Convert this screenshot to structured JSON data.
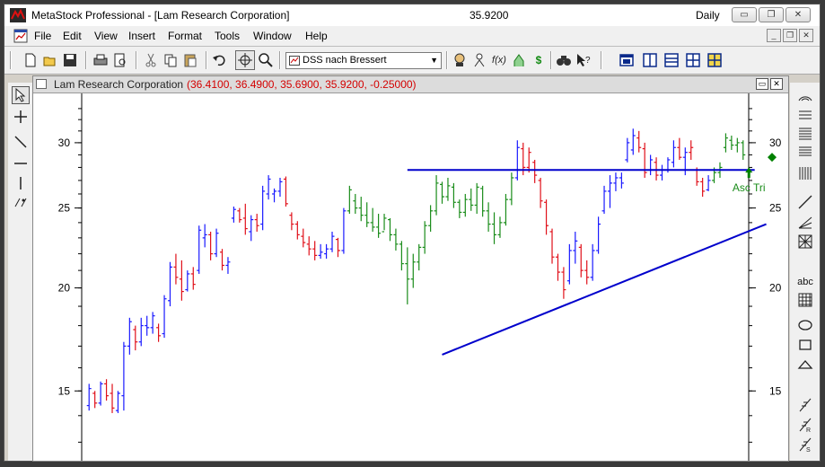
{
  "window": {
    "title": "MetaStock Professional - [Lam Research Corporation]",
    "price": "35.9200",
    "period": "Daily",
    "minimize": "▭",
    "restore": "❐",
    "close": "✕"
  },
  "menu": {
    "items": [
      "File",
      "Edit",
      "View",
      "Insert",
      "Format",
      "Tools",
      "Window",
      "Help"
    ],
    "mdi_minimize": "_",
    "mdi_restore": "❐",
    "mdi_close": "✕"
  },
  "toolbar": {
    "combo_value": "DSS nach Bressert",
    "icons": [
      "new-icon",
      "open-icon",
      "save-icon",
      "print-icon",
      "print-preview-icon",
      "cut-icon",
      "copy-icon",
      "paste-icon",
      "undo-icon",
      "crosshair-icon",
      "zoom-icon",
      "expert-icon",
      "explorer-icon",
      "formula-icon",
      "indicator-icon",
      "dollar-icon",
      "binoculars-icon",
      "help-pointer-icon",
      "tile-icon",
      "cascade-icon",
      "horizontal-icon",
      "vertical-icon",
      "smart-chart-icon"
    ],
    "formula_label": "f(x)",
    "dollar_label": "$"
  },
  "chart_window": {
    "name": "Lam Research Corporation",
    "values": "(36.4100, 36.4900, 35.6900, 35.9200, -0.25000)"
  },
  "chart_data": {
    "type": "ohlc-bar",
    "symbol": "Lam Research Corporation",
    "scale": "log",
    "ylim": [
      12.5,
      34
    ],
    "yticks": [
      15,
      20,
      25,
      30
    ],
    "colors": {
      "up": "#1a1aff",
      "down": "#e0101a",
      "neutral": "#1a8c1a",
      "trendline": "#0000cc",
      "signal": "#008000"
    },
    "annotation": {
      "text": "Asc Tri",
      "color": "#1a8c1a"
    },
    "trendlines": [
      {
        "name": "resistance",
        "from": {
          "bar": 55,
          "price": 27.8
        },
        "to": {
          "bar": 115,
          "price": 27.8
        }
      },
      {
        "name": "support",
        "from": {
          "bar": 61,
          "price": 16.6
        },
        "to": {
          "bar": 117,
          "price": 23.9
        }
      }
    ],
    "bars": [
      {
        "h": 15.3,
        "l": 14.2,
        "o": 14.4,
        "c": 15.1,
        "col": "up"
      },
      {
        "h": 15.0,
        "l": 14.3,
        "o": 14.9,
        "c": 14.5,
        "col": "down"
      },
      {
        "h": 15.4,
        "l": 14.4,
        "o": 14.5,
        "c": 15.3,
        "col": "up"
      },
      {
        "h": 15.5,
        "l": 14.6,
        "o": 15.3,
        "c": 14.8,
        "col": "down"
      },
      {
        "h": 15.3,
        "l": 14.1,
        "o": 14.9,
        "c": 14.3,
        "col": "down"
      },
      {
        "h": 15.0,
        "l": 14.1,
        "o": 14.2,
        "c": 14.9,
        "col": "up"
      },
      {
        "h": 17.2,
        "l": 14.2,
        "o": 14.8,
        "c": 17.0,
        "col": "up"
      },
      {
        "h": 18.4,
        "l": 16.6,
        "o": 17.0,
        "c": 18.2,
        "col": "up"
      },
      {
        "h": 18.0,
        "l": 16.8,
        "o": 17.8,
        "c": 17.2,
        "col": "down"
      },
      {
        "h": 18.4,
        "l": 17.0,
        "o": 17.2,
        "c": 18.0,
        "col": "up"
      },
      {
        "h": 18.5,
        "l": 17.5,
        "o": 18.0,
        "c": 17.9,
        "col": "up"
      },
      {
        "h": 18.7,
        "l": 17.6,
        "o": 17.9,
        "c": 18.5,
        "col": "up"
      },
      {
        "h": 18.1,
        "l": 17.2,
        "o": 17.9,
        "c": 17.5,
        "col": "down"
      },
      {
        "h": 19.6,
        "l": 17.4,
        "o": 17.6,
        "c": 19.4,
        "col": "up"
      },
      {
        "h": 21.5,
        "l": 19.0,
        "o": 19.3,
        "c": 21.2,
        "col": "up"
      },
      {
        "h": 22.0,
        "l": 20.2,
        "o": 21.2,
        "c": 20.6,
        "col": "down"
      },
      {
        "h": 21.6,
        "l": 19.3,
        "o": 20.5,
        "c": 19.8,
        "col": "down"
      },
      {
        "h": 21.0,
        "l": 19.8,
        "o": 19.9,
        "c": 20.8,
        "col": "up"
      },
      {
        "h": 21.2,
        "l": 19.9,
        "o": 20.8,
        "c": 20.2,
        "col": "down"
      },
      {
        "h": 23.8,
        "l": 20.8,
        "o": 21.0,
        "c": 23.5,
        "col": "up"
      },
      {
        "h": 23.9,
        "l": 22.4,
        "o": 23.0,
        "c": 23.2,
        "col": "up"
      },
      {
        "h": 23.4,
        "l": 21.6,
        "o": 23.2,
        "c": 22.0,
        "col": "down"
      },
      {
        "h": 23.6,
        "l": 21.8,
        "o": 22.0,
        "c": 23.3,
        "col": "up"
      },
      {
        "h": 22.3,
        "l": 21.0,
        "o": 22.1,
        "c": 21.3,
        "col": "down"
      },
      {
        "h": 21.8,
        "l": 20.8,
        "o": 21.3,
        "c": 21.5,
        "col": "up"
      },
      {
        "h": 25.1,
        "l": 24.0,
        "o": 24.3,
        "c": 24.9,
        "col": "up"
      },
      {
        "h": 25.0,
        "l": 24.0,
        "o": 24.8,
        "c": 24.2,
        "col": "down"
      },
      {
        "h": 25.3,
        "l": 23.2,
        "o": 24.3,
        "c": 23.6,
        "col": "down"
      },
      {
        "h": 24.5,
        "l": 22.8,
        "o": 23.4,
        "c": 24.2,
        "col": "up"
      },
      {
        "h": 24.6,
        "l": 23.4,
        "o": 24.2,
        "c": 23.8,
        "col": "down"
      },
      {
        "h": 26.6,
        "l": 23.5,
        "o": 23.9,
        "c": 26.2,
        "col": "up"
      },
      {
        "h": 27.4,
        "l": 25.6,
        "o": 26.0,
        "c": 27.1,
        "col": "up"
      },
      {
        "h": 26.4,
        "l": 25.4,
        "o": 26.0,
        "c": 26.2,
        "col": "up"
      },
      {
        "h": 27.2,
        "l": 25.8,
        "o": 26.2,
        "c": 26.9,
        "col": "up"
      },
      {
        "h": 27.3,
        "l": 25.1,
        "o": 27.1,
        "c": 25.3,
        "col": "down"
      },
      {
        "h": 24.7,
        "l": 23.5,
        "o": 24.5,
        "c": 23.9,
        "col": "down"
      },
      {
        "h": 24.1,
        "l": 22.9,
        "o": 23.9,
        "c": 23.2,
        "col": "down"
      },
      {
        "h": 23.6,
        "l": 22.4,
        "o": 23.1,
        "c": 22.7,
        "col": "down"
      },
      {
        "h": 23.1,
        "l": 21.9,
        "o": 22.6,
        "c": 22.3,
        "col": "down"
      },
      {
        "h": 22.8,
        "l": 21.6,
        "o": 22.3,
        "c": 21.9,
        "col": "down"
      },
      {
        "h": 22.6,
        "l": 21.7,
        "o": 21.9,
        "c": 22.1,
        "col": "up"
      },
      {
        "h": 22.6,
        "l": 21.7,
        "o": 22.0,
        "c": 22.3,
        "col": "up"
      },
      {
        "h": 23.4,
        "l": 22.1,
        "o": 22.3,
        "c": 23.1,
        "col": "up"
      },
      {
        "h": 23.0,
        "l": 21.8,
        "o": 22.9,
        "c": 22.2,
        "col": "down"
      },
      {
        "h": 25.0,
        "l": 22.0,
        "o": 22.2,
        "c": 24.8,
        "col": "up"
      },
      {
        "h": 26.6,
        "l": 24.6,
        "o": 24.8,
        "c": 26.3,
        "col": "neutral"
      },
      {
        "h": 26.0,
        "l": 24.6,
        "o": 25.5,
        "c": 25.0,
        "col": "neutral"
      },
      {
        "h": 25.8,
        "l": 24.1,
        "o": 25.0,
        "c": 24.5,
        "col": "neutral"
      },
      {
        "h": 25.4,
        "l": 23.7,
        "o": 24.5,
        "c": 24.0,
        "col": "neutral"
      },
      {
        "h": 25.0,
        "l": 23.4,
        "o": 24.0,
        "c": 23.7,
        "col": "neutral"
      },
      {
        "h": 24.6,
        "l": 23.0,
        "o": 23.7,
        "c": 23.3,
        "col": "neutral"
      },
      {
        "h": 24.6,
        "l": 23.5,
        "o": 23.4,
        "c": 24.3,
        "col": "neutral"
      },
      {
        "h": 24.3,
        "l": 22.8,
        "o": 24.2,
        "c": 23.2,
        "col": "neutral"
      },
      {
        "h": 23.6,
        "l": 22.2,
        "o": 23.2,
        "c": 22.6,
        "col": "neutral"
      },
      {
        "h": 22.8,
        "l": 21.0,
        "o": 22.6,
        "c": 21.4,
        "col": "neutral"
      },
      {
        "h": 22.4,
        "l": 19.1,
        "o": 21.4,
        "c": 20.5,
        "col": "neutral"
      },
      {
        "h": 22.0,
        "l": 20.0,
        "o": 20.5,
        "c": 21.5,
        "col": "neutral"
      },
      {
        "h": 22.6,
        "l": 21.0,
        "o": 21.5,
        "c": 22.4,
        "col": "neutral"
      },
      {
        "h": 24.1,
        "l": 22.0,
        "o": 22.4,
        "c": 23.8,
        "col": "neutral"
      },
      {
        "h": 25.2,
        "l": 23.4,
        "o": 23.8,
        "c": 24.8,
        "col": "neutral"
      },
      {
        "h": 27.4,
        "l": 24.5,
        "o": 24.8,
        "c": 26.8,
        "col": "neutral"
      },
      {
        "h": 26.9,
        "l": 25.3,
        "o": 26.7,
        "c": 25.8,
        "col": "neutral"
      },
      {
        "h": 27.2,
        "l": 25.5,
        "o": 25.8,
        "c": 26.6,
        "col": "neutral"
      },
      {
        "h": 26.8,
        "l": 25.0,
        "o": 26.5,
        "c": 25.4,
        "col": "neutral"
      },
      {
        "h": 25.6,
        "l": 24.3,
        "o": 25.4,
        "c": 24.7,
        "col": "neutral"
      },
      {
        "h": 26.0,
        "l": 24.4,
        "o": 24.7,
        "c": 25.6,
        "col": "neutral"
      },
      {
        "h": 26.4,
        "l": 24.8,
        "o": 25.6,
        "c": 25.2,
        "col": "neutral"
      },
      {
        "h": 26.8,
        "l": 24.6,
        "o": 25.2,
        "c": 26.5,
        "col": "neutral"
      },
      {
        "h": 26.6,
        "l": 24.4,
        "o": 26.4,
        "c": 24.8,
        "col": "neutral"
      },
      {
        "h": 25.4,
        "l": 23.4,
        "o": 24.8,
        "c": 23.9,
        "col": "neutral"
      },
      {
        "h": 24.7,
        "l": 22.6,
        "o": 23.9,
        "c": 23.2,
        "col": "neutral"
      },
      {
        "h": 24.4,
        "l": 23.0,
        "o": 23.2,
        "c": 24.0,
        "col": "neutral"
      },
      {
        "h": 26.0,
        "l": 23.8,
        "o": 24.0,
        "c": 25.6,
        "col": "neutral"
      },
      {
        "h": 27.6,
        "l": 25.2,
        "o": 25.6,
        "c": 27.2,
        "col": "neutral"
      },
      {
        "h": 30.2,
        "l": 27.0,
        "o": 27.2,
        "c": 29.6,
        "col": "up"
      },
      {
        "h": 30.0,
        "l": 27.4,
        "o": 29.5,
        "c": 28.0,
        "col": "down"
      },
      {
        "h": 29.6,
        "l": 27.6,
        "o": 28.0,
        "c": 29.2,
        "col": "down"
      },
      {
        "h": 28.6,
        "l": 26.8,
        "o": 28.4,
        "c": 27.4,
        "col": "down"
      },
      {
        "h": 27.2,
        "l": 25.0,
        "o": 27.0,
        "c": 25.5,
        "col": "down"
      },
      {
        "h": 25.6,
        "l": 23.2,
        "o": 25.4,
        "c": 23.8,
        "col": "down"
      },
      {
        "h": 23.6,
        "l": 21.4,
        "o": 23.4,
        "c": 21.8,
        "col": "down"
      },
      {
        "h": 22.0,
        "l": 20.4,
        "o": 21.8,
        "c": 20.9,
        "col": "down"
      },
      {
        "h": 21.2,
        "l": 19.4,
        "o": 20.9,
        "c": 19.9,
        "col": "down"
      },
      {
        "h": 22.6,
        "l": 20.2,
        "o": 20.4,
        "c": 22.2,
        "col": "up"
      },
      {
        "h": 23.4,
        "l": 21.4,
        "o": 22.2,
        "c": 22.8,
        "col": "up"
      },
      {
        "h": 22.6,
        "l": 20.6,
        "o": 22.4,
        "c": 21.0,
        "col": "down"
      },
      {
        "h": 21.6,
        "l": 20.2,
        "o": 21.0,
        "c": 20.6,
        "col": "down"
      },
      {
        "h": 22.6,
        "l": 20.4,
        "o": 20.6,
        "c": 22.2,
        "col": "up"
      },
      {
        "h": 24.4,
        "l": 22.0,
        "o": 22.2,
        "c": 23.9,
        "col": "up"
      },
      {
        "h": 26.6,
        "l": 24.6,
        "o": 24.8,
        "c": 26.2,
        "col": "up"
      },
      {
        "h": 27.4,
        "l": 25.0,
        "o": 26.2,
        "c": 26.8,
        "col": "up"
      },
      {
        "h": 27.6,
        "l": 26.2,
        "o": 26.8,
        "c": 27.2,
        "col": "up"
      },
      {
        "h": 27.6,
        "l": 26.4,
        "o": 27.2,
        "c": 26.8,
        "col": "up"
      },
      {
        "h": 30.4,
        "l": 28.4,
        "o": 28.6,
        "c": 30.0,
        "col": "up"
      },
      {
        "h": 31.2,
        "l": 29.0,
        "o": 29.4,
        "c": 30.6,
        "col": "up"
      },
      {
        "h": 31.0,
        "l": 29.2,
        "o": 30.4,
        "c": 29.6,
        "col": "down"
      },
      {
        "h": 30.0,
        "l": 27.2,
        "o": 29.5,
        "c": 27.6,
        "col": "down"
      },
      {
        "h": 29.0,
        "l": 27.4,
        "o": 27.8,
        "c": 28.6,
        "col": "up"
      },
      {
        "h": 28.8,
        "l": 27.0,
        "o": 28.4,
        "c": 27.4,
        "col": "down"
      },
      {
        "h": 28.2,
        "l": 27.0,
        "o": 27.4,
        "c": 27.8,
        "col": "up"
      },
      {
        "h": 28.8,
        "l": 27.6,
        "o": 27.8,
        "c": 28.6,
        "col": "up"
      },
      {
        "h": 30.2,
        "l": 28.0,
        "o": 28.4,
        "c": 29.6,
        "col": "up"
      },
      {
        "h": 30.4,
        "l": 28.6,
        "o": 29.6,
        "c": 28.8,
        "col": "down"
      },
      {
        "h": 29.6,
        "l": 27.4,
        "o": 28.8,
        "c": 29.2,
        "col": "up"
      },
      {
        "h": 30.2,
        "l": 28.6,
        "o": 29.2,
        "c": 29.6,
        "col": "down"
      },
      {
        "h": 28.0,
        "l": 26.6,
        "o": 27.8,
        "c": 26.9,
        "col": "down"
      },
      {
        "h": 27.2,
        "l": 25.8,
        "o": 26.9,
        "c": 26.2,
        "col": "down"
      },
      {
        "h": 27.4,
        "l": 26.2,
        "o": 26.3,
        "c": 27.0,
        "col": "up"
      },
      {
        "h": 28.0,
        "l": 26.8,
        "o": 27.0,
        "c": 27.6,
        "col": "neutral"
      },
      {
        "h": 28.4,
        "l": 27.2,
        "o": 27.6,
        "c": 28.0,
        "col": "neutral"
      },
      {
        "h": 30.8,
        "l": 29.2,
        "o": 29.6,
        "c": 30.4,
        "col": "neutral"
      },
      {
        "h": 30.6,
        "l": 29.4,
        "o": 30.2,
        "c": 29.8,
        "col": "neutral"
      },
      {
        "h": 30.4,
        "l": 29.2,
        "o": 29.8,
        "c": 30.0,
        "col": "neutral"
      },
      {
        "h": 30.2,
        "l": 28.6,
        "o": 30.0,
        "c": 29.0,
        "col": "neutral"
      }
    ],
    "signals": [
      {
        "type": "arrow-up",
        "bar": 114,
        "price": 27.6
      },
      {
        "type": "diamond",
        "bar": 118,
        "price": 28.8
      }
    ]
  },
  "left_tools": [
    "pointer-icon",
    "crosshair-tool-icon",
    "trendline-tool-icon",
    "horizontal-line-icon",
    "vertical-line-icon",
    "cycle-lines-icon"
  ],
  "right_tools": [
    "gann-fan-icon",
    "fibonacci-arcs-icon",
    "fibonacci-retracement-icon",
    "speed-lines-icon",
    "time-zones-icon",
    "raff-channel-icon",
    "andrews-pitchfork-icon",
    "gann-grid-icon",
    "text-tool-icon",
    "grid-box-icon",
    "ellipse-icon",
    "rectangle-icon",
    "triangle-icon",
    "buy-arrow-icon",
    "sell-arrow-icon",
    "exit-arrow-icon"
  ],
  "right_labels": {
    "text_tool": "abc"
  }
}
